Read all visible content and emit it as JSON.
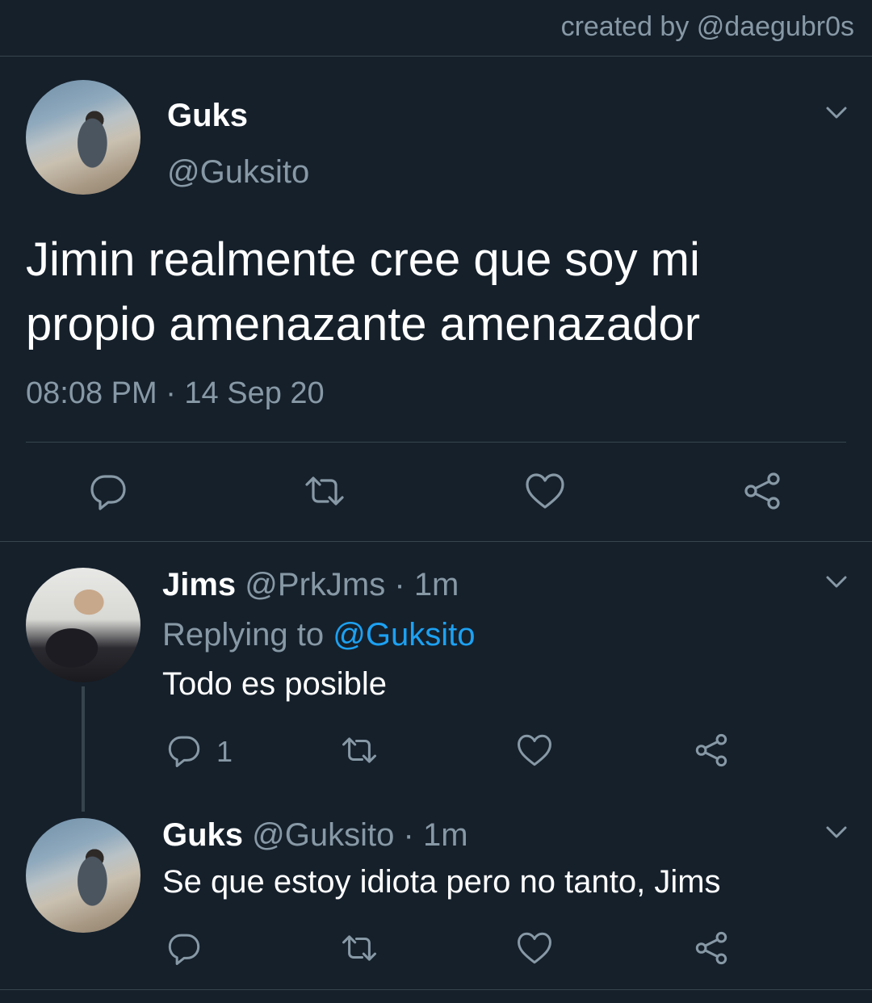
{
  "credit": "created by @daegubr0s",
  "main_tweet": {
    "name": "Guks",
    "handle": "@Guksito",
    "text_line1": "Jimin realmente cree que soy mi",
    "text_line2": "propio amenazante amenazador",
    "timestamp": "08:08 PM · 14 Sep 20"
  },
  "replies": [
    {
      "name": "Jims",
      "handle": "@PrkJms",
      "time": "1m",
      "replying_prefix": "Replying to ",
      "replying_to": "@Guksito",
      "text": "Todo es posible",
      "reply_count": "1"
    },
    {
      "name": "Guks",
      "handle": "@Guksito",
      "time": "1m",
      "text": "Se que estoy idiota pero no tanto, Jims"
    }
  ],
  "colors": {
    "background": "#15202b",
    "secondary_text": "#8899a6",
    "link": "#1da1f2",
    "divider": "#38444d"
  },
  "icons": [
    "reply-icon",
    "retweet-icon",
    "like-icon",
    "share-icon",
    "chevron-down-icon"
  ]
}
